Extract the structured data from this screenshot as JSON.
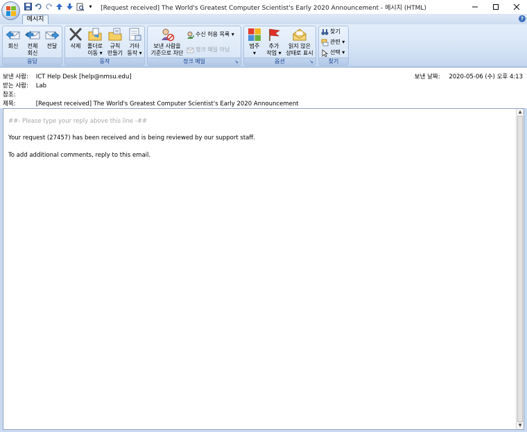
{
  "window": {
    "title": "[Request received] The World's Greatest Computer Scientist's Early 2020 Announcement - 메시지 (HTML)"
  },
  "ribbon": {
    "tab": "메시지",
    "groups": {
      "respond": {
        "label": "응답",
        "reply": "회신",
        "reply_all_1": "전체",
        "reply_all_2": "회신",
        "forward": "전달"
      },
      "actions": {
        "label": "동작",
        "delete": "삭제",
        "move_1": "폴더로",
        "move_2": "이동 ▾",
        "rules_1": "규칙",
        "rules_2": "만들기",
        "other_1": "기타",
        "other_2": "동작 ▾"
      },
      "junk": {
        "label": "정크 메일",
        "block_1": "보낸 사람을",
        "block_2": "기준으로 차단",
        "safe_list": "수신 허용 목록 ▾",
        "not_junk": "정크 메일 아님"
      },
      "options": {
        "label": "옵션",
        "categorize_1": "범주",
        "categorize_2": "▾",
        "followup_1": "추가",
        "followup_2": "작업 ▾",
        "mark_unread_1": "읽지 않은",
        "mark_unread_2": "상태로 표시"
      },
      "find": {
        "label": "찾기",
        "find": "찾기",
        "related": "관련 ▾",
        "select": "선택 ▾"
      }
    }
  },
  "header": {
    "from_label": "보낸 사람:",
    "from": "ICT Help Desk [help@nmsu.edu]",
    "to_label": "받는 사람:",
    "to": "Lab",
    "cc_label": "참조:",
    "cc": "",
    "subject_label": "제목:",
    "subject": "[Request received] The World's Greatest Computer Scientist's Early 2020 Announcement",
    "sent_label": "보낸 날짜:",
    "sent": "2020-05-06 (수) 오후 4:13"
  },
  "body": {
    "reply_line": "##- Please type your reply above this line -##",
    "line1": "Your request (27457) has been received and is being reviewed by our support staff.",
    "line2": "To add additional comments, reply to this email."
  }
}
